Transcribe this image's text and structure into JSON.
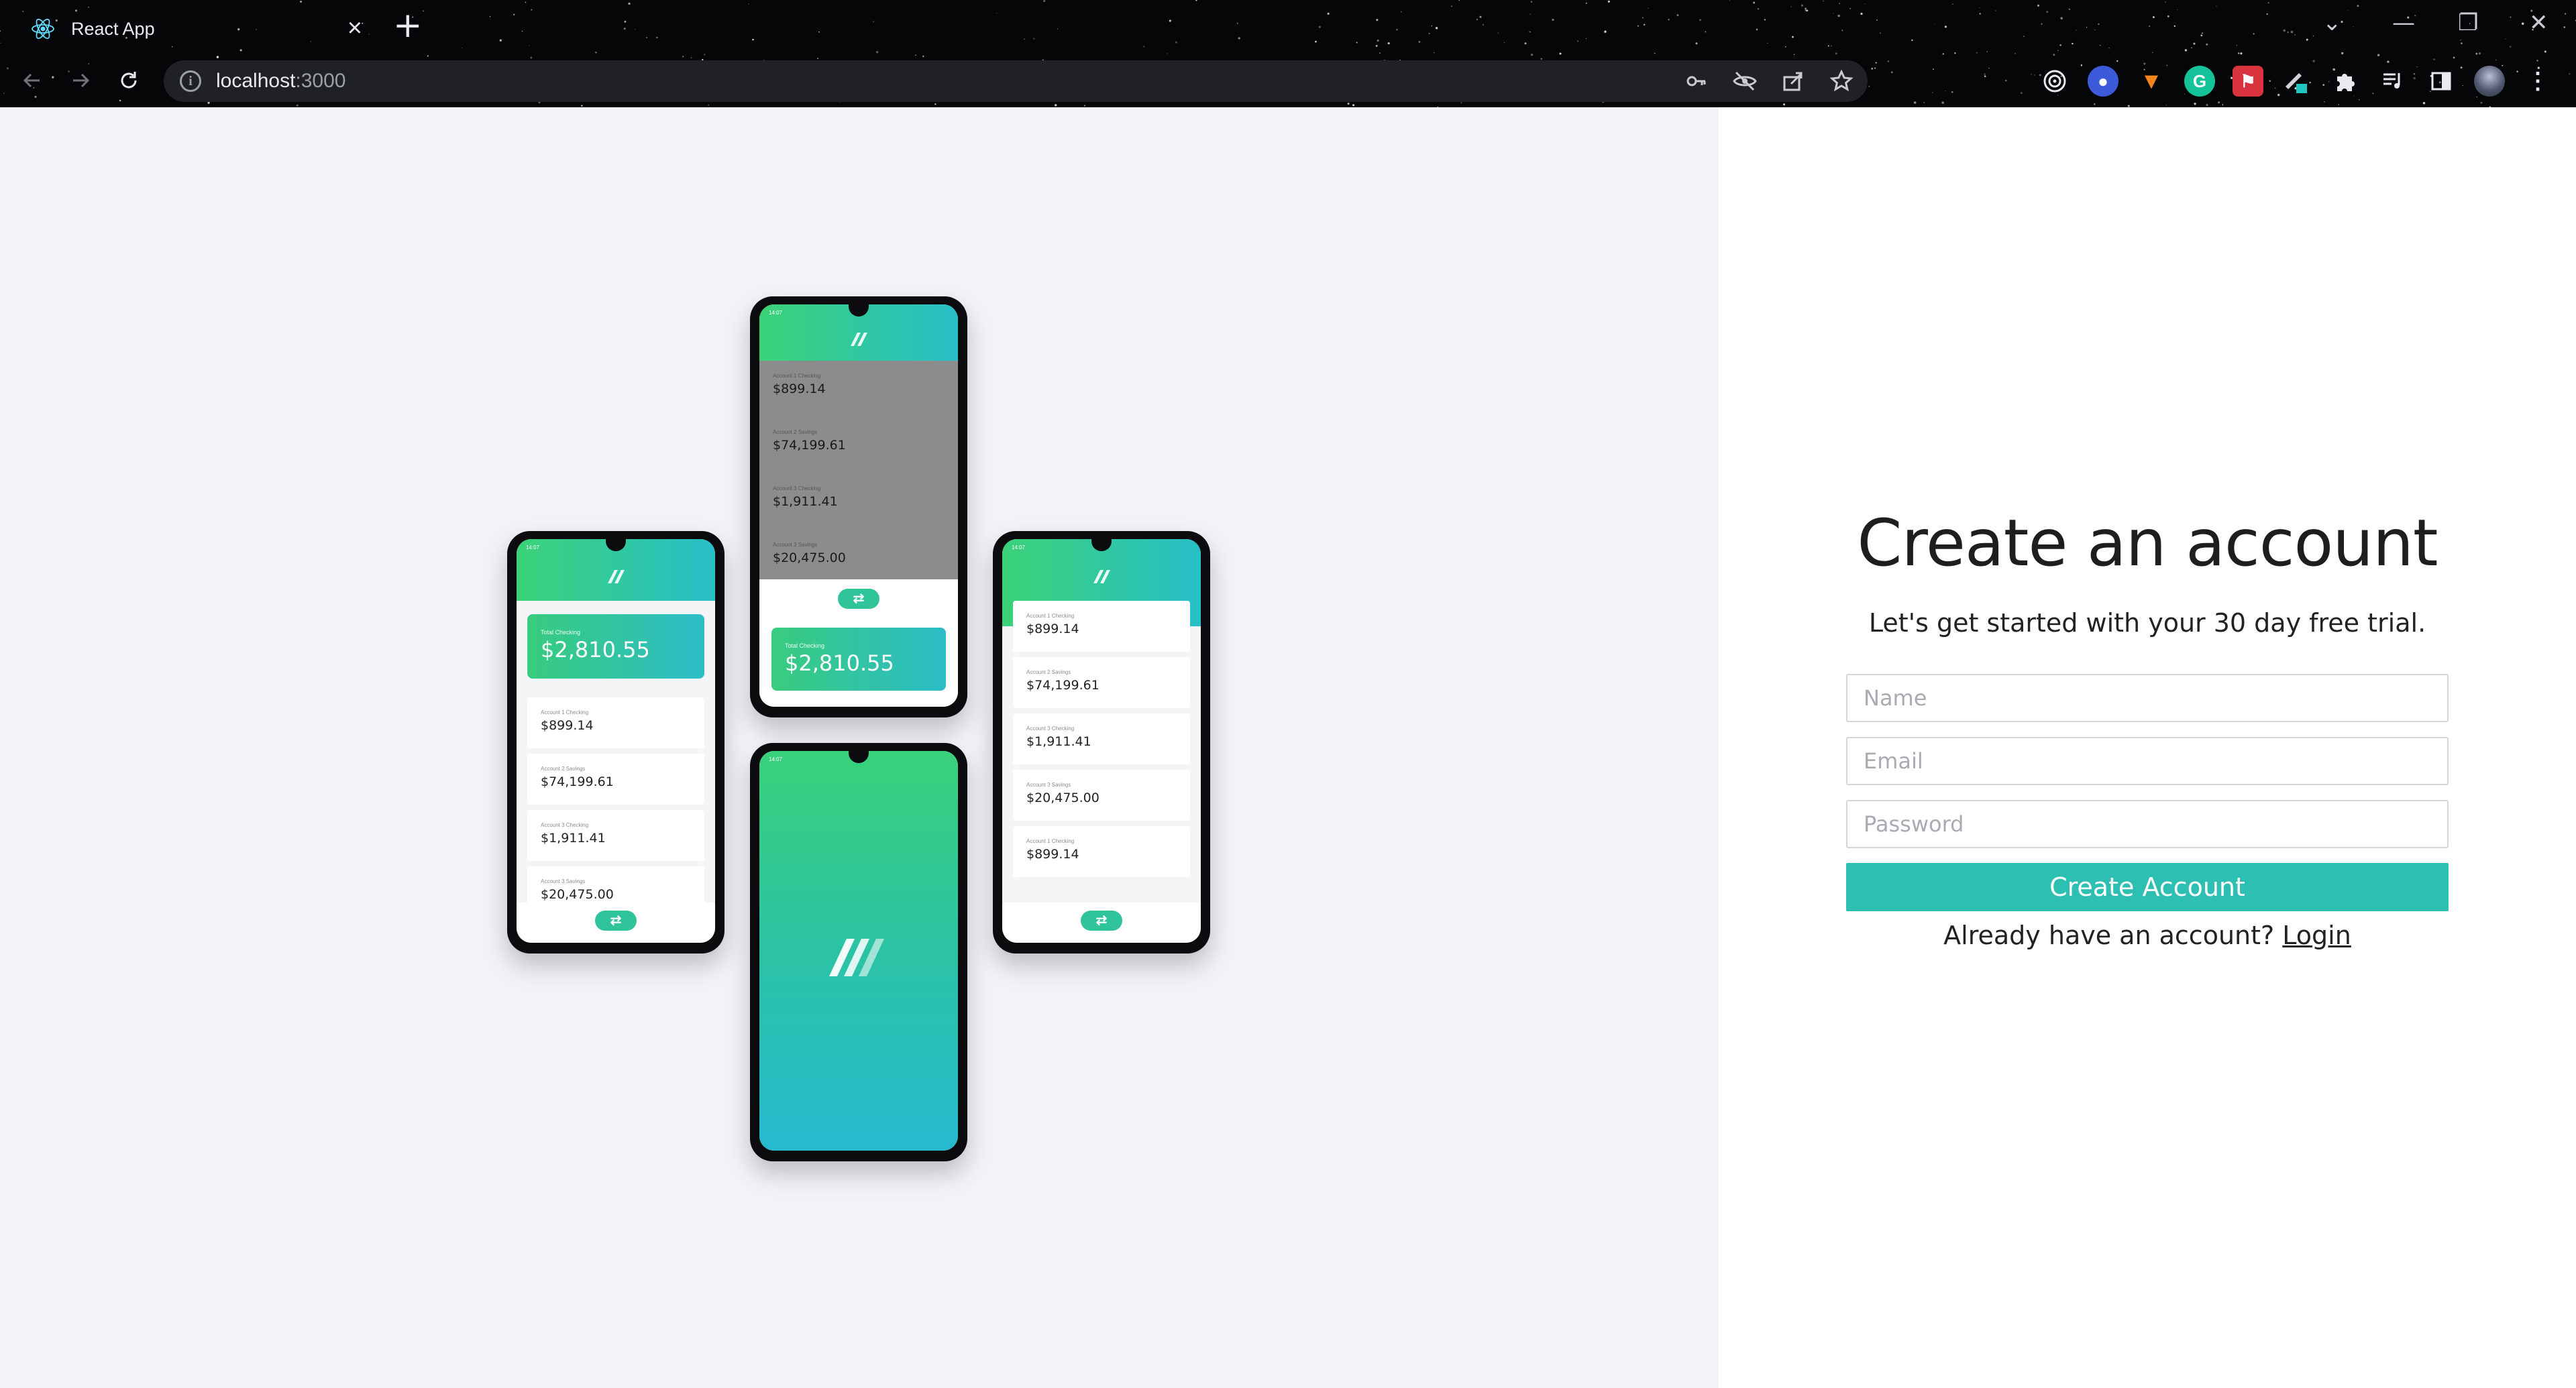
{
  "browser": {
    "tab_title": "React App",
    "url_host": "localhost",
    "url_port": ":3000"
  },
  "colors": {
    "accent": "#2ebfb3",
    "gradient_start": "#3bd277",
    "gradient_end": "#27bfc8"
  },
  "form": {
    "title": "Create an account",
    "subtitle": "Let's get started with your 30 day free trial.",
    "name_placeholder": "Name",
    "email_placeholder": "Email",
    "password_placeholder": "Password",
    "submit_label": "Create Account",
    "login_prompt": "Already have an account?",
    "login_link": "Login"
  },
  "phones": {
    "left": {
      "total_label": "Total Checking",
      "total_amount": "$2,810.55",
      "accounts": [
        {
          "label": "Account 1 Checking",
          "amount": "$899.14"
        },
        {
          "label": "Account 2 Savings",
          "amount": "$74,199.61"
        },
        {
          "label": "Account 3 Checking",
          "amount": "$1,911.41"
        },
        {
          "label": "Account 3 Savings",
          "amount": "$20,475.00"
        }
      ]
    },
    "top": {
      "accounts": [
        {
          "label": "Account 1 Checking",
          "amount": "$899.14"
        },
        {
          "label": "Account 2 Savings",
          "amount": "$74,199.61"
        },
        {
          "label": "Account 3 Checking",
          "amount": "$1,911.41"
        },
        {
          "label": "Account 3 Savings",
          "amount": "$20,475.00"
        }
      ],
      "total_label": "Total Checking",
      "total_amount": "$2,810.55"
    },
    "right": {
      "accounts": [
        {
          "label": "Account 1 Checking",
          "amount": "$899.14"
        },
        {
          "label": "Account 2 Savings",
          "amount": "$74,199.61"
        },
        {
          "label": "Account 3 Checking",
          "amount": "$1,911.41"
        },
        {
          "label": "Account 3 Savings",
          "amount": "$20,475.00"
        },
        {
          "label": "Account 1 Checking",
          "amount": "$899.14"
        }
      ]
    }
  }
}
